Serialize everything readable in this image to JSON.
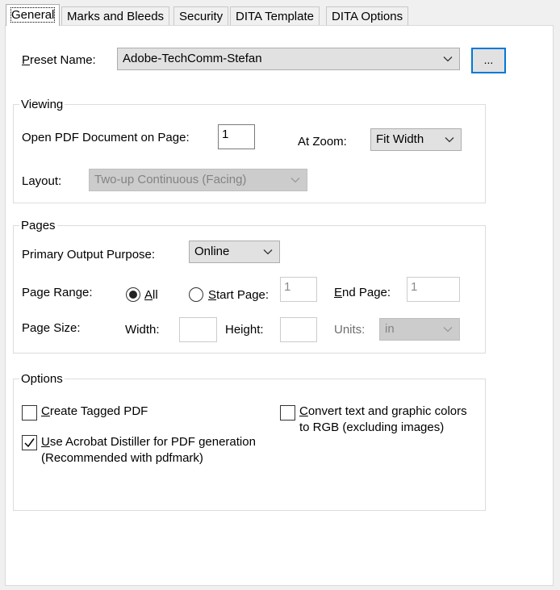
{
  "tabs": [
    {
      "label": "General"
    },
    {
      "label": "Marks and Bleeds"
    },
    {
      "label": "Security"
    },
    {
      "label": "DITA Template"
    },
    {
      "label": "DITA Options"
    }
  ],
  "preset": {
    "label_prefix": "P",
    "label_rest": "reset Name:",
    "value": "Adobe-TechComm-Stefan",
    "browse_label": "..."
  },
  "viewing": {
    "title": "Viewing",
    "open_label": "Open PDF Document on Page:",
    "open_value": "1",
    "zoom_label": "At Zoom:",
    "zoom_value": "Fit Width",
    "layout_label": "Layout:",
    "layout_value": "Two-up Continuous (Facing)"
  },
  "pages": {
    "title": "Pages",
    "purpose_label": "Primary Output Purpose:",
    "purpose_value": "Online",
    "range_label": "Page Range:",
    "all_prefix": "A",
    "all_rest": "ll",
    "start_prefix": "S",
    "start_rest": "tart Page:",
    "start_value": "1",
    "end_prefix": "E",
    "end_rest": "nd Page:",
    "end_value": "1",
    "size_label": "Page Size:",
    "width_label": "Width:",
    "width_value": "",
    "height_label": "Height:",
    "height_value": "",
    "units_label": "Units:",
    "units_value": "in",
    "range_selected": "All"
  },
  "options": {
    "title": "Options",
    "tagged_prefix": "C",
    "tagged_rest": "reate Tagged PDF",
    "tagged_checked": false,
    "distiller_prefix": "U",
    "distiller_rest": "se Acrobat Distiller for PDF generation",
    "distiller_line2": "(Recommended with pdfmark)",
    "distiller_checked": true,
    "rgb_prefix": "C",
    "rgb_rest": "onvert text and graphic colors",
    "rgb_line2": "to RGB (excluding images)",
    "rgb_checked": false
  },
  "colors": {
    "focus_border": "#0078d7",
    "disabled_text": "#838383"
  }
}
